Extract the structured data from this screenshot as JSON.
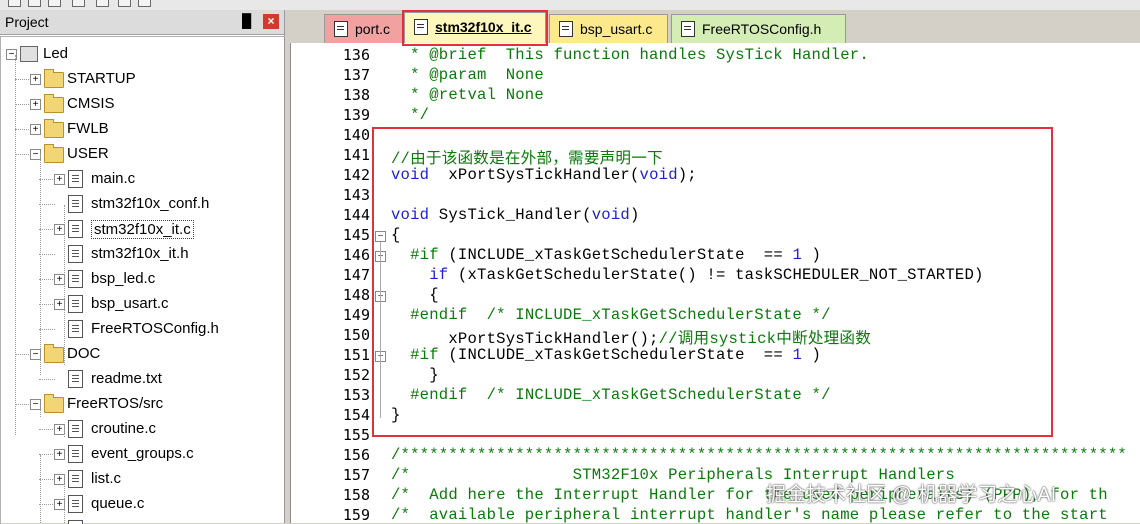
{
  "toolbar": {
    "icons": [
      "arrow-icon",
      "file-icon",
      "file-icon",
      "build-icon",
      "save-icon",
      "file-icon",
      "debug-icon"
    ]
  },
  "panel": {
    "title": "Project",
    "pin": "█",
    "close": "×"
  },
  "tree": [
    {
      "label": "Led",
      "kind": "root",
      "level": 0,
      "expander": "−"
    },
    {
      "label": "STARTUP",
      "kind": "folder",
      "level": 1,
      "expander": "+"
    },
    {
      "label": "CMSIS",
      "kind": "folder",
      "level": 1,
      "expander": "+"
    },
    {
      "label": "FWLB",
      "kind": "folder",
      "level": 1,
      "expander": "+"
    },
    {
      "label": "USER",
      "kind": "folder-open",
      "level": 1,
      "expander": "−"
    },
    {
      "label": "main.c",
      "kind": "file",
      "level": 2,
      "expander": "+"
    },
    {
      "label": "stm32f10x_conf.h",
      "kind": "file",
      "level": 2,
      "expander": ""
    },
    {
      "label": "stm32f10x_it.c",
      "kind": "file",
      "level": 2,
      "expander": "+",
      "selected": true
    },
    {
      "label": "stm32f10x_it.h",
      "kind": "file",
      "level": 2,
      "expander": ""
    },
    {
      "label": "bsp_led.c",
      "kind": "file",
      "level": 2,
      "expander": "+"
    },
    {
      "label": "bsp_usart.c",
      "kind": "file",
      "level": 2,
      "expander": "+"
    },
    {
      "label": "FreeRTOSConfig.h",
      "kind": "file",
      "level": 2,
      "expander": ""
    },
    {
      "label": "DOC",
      "kind": "folder-open",
      "level": 1,
      "expander": "−"
    },
    {
      "label": "readme.txt",
      "kind": "file",
      "level": 2,
      "expander": ""
    },
    {
      "label": "FreeRTOS/src",
      "kind": "folder-open",
      "level": 1,
      "expander": "−"
    },
    {
      "label": "croutine.c",
      "kind": "file",
      "level": 2,
      "expander": "+"
    },
    {
      "label": "event_groups.c",
      "kind": "file",
      "level": 2,
      "expander": "+"
    },
    {
      "label": "list.c",
      "kind": "file",
      "level": 2,
      "expander": "+"
    },
    {
      "label": "queue.c",
      "kind": "file",
      "level": 2,
      "expander": "+"
    },
    {
      "label": "",
      "kind": "file",
      "level": 2,
      "expander": "+"
    }
  ],
  "tabs": [
    {
      "label": "port.c",
      "bg": "#f2a1a1"
    },
    {
      "label": "stm32f10x_it.c",
      "bg": "#fdf6bd",
      "active": true
    },
    {
      "label": "bsp_usart.c",
      "bg": "#fbe98c"
    },
    {
      "label": "FreeRTOSConfig.h",
      "bg": "#d4edb5"
    }
  ],
  "editor": {
    "lines": [
      {
        "n": "136",
        "segs": [
          [
            "c-com",
            "  * @brief  This function handles SysTick Handler."
          ]
        ]
      },
      {
        "n": "137",
        "segs": [
          [
            "c-com",
            "  * @param  None"
          ]
        ]
      },
      {
        "n": "138",
        "segs": [
          [
            "c-com",
            "  * @retval None"
          ]
        ]
      },
      {
        "n": "139",
        "segs": [
          [
            "c-com",
            "  */"
          ]
        ]
      },
      {
        "n": "140",
        "segs": []
      },
      {
        "n": "141",
        "segs": [
          [
            "c-com",
            "//由于该函数是在外部，需要声明一下"
          ]
        ]
      },
      {
        "n": "142",
        "segs": [
          [
            "c-kw",
            "void"
          ],
          [
            "",
            "  xPortSysTickHandler("
          ],
          [
            "c-kw",
            "void"
          ],
          [
            "",
            ");"
          ]
        ]
      },
      {
        "n": "143",
        "segs": []
      },
      {
        "n": "144",
        "segs": [
          [
            "c-kw",
            "void"
          ],
          [
            "",
            " SysTick_Handler("
          ],
          [
            "c-kw",
            "void"
          ],
          [
            "",
            ")"
          ]
        ]
      },
      {
        "n": "145",
        "segs": [
          [
            "",
            "{"
          ]
        ]
      },
      {
        "n": "146",
        "segs": [
          [
            "c-pp",
            "  #if"
          ],
          [
            "",
            " (INCLUDE_xTaskGetSchedulerState  == "
          ],
          [
            "c-num",
            "1"
          ],
          [
            "",
            " )"
          ]
        ]
      },
      {
        "n": "147",
        "segs": [
          [
            "c-kw",
            "    if"
          ],
          [
            "",
            " (xTaskGetSchedulerState() != taskSCHEDULER_NOT_STARTED)"
          ]
        ]
      },
      {
        "n": "148",
        "segs": [
          [
            "",
            "    {"
          ]
        ]
      },
      {
        "n": "149",
        "segs": [
          [
            "c-pp",
            "  #endif"
          ],
          [
            "c-com",
            "  /* INCLUDE_xTaskGetSchedulerState */"
          ]
        ]
      },
      {
        "n": "150",
        "segs": [
          [
            "",
            "      xPortSysTickHandler();"
          ],
          [
            "c-com",
            "//调用systick中断处理函数"
          ]
        ]
      },
      {
        "n": "151",
        "segs": [
          [
            "c-pp",
            "  #if"
          ],
          [
            "",
            " (INCLUDE_xTaskGetSchedulerState  == "
          ],
          [
            "c-num",
            "1"
          ],
          [
            "",
            " )"
          ]
        ]
      },
      {
        "n": "152",
        "segs": [
          [
            "",
            "    }"
          ]
        ]
      },
      {
        "n": "153",
        "segs": [
          [
            "c-pp",
            "  #endif"
          ],
          [
            "c-com",
            "  /* INCLUDE_xTaskGetSchedulerState */"
          ]
        ]
      },
      {
        "n": "154",
        "segs": [
          [
            "",
            "}"
          ]
        ]
      },
      {
        "n": "155",
        "segs": []
      },
      {
        "n": "156",
        "segs": [
          [
            "c-com",
            "/****************************************************************************"
          ]
        ]
      },
      {
        "n": "157",
        "segs": [
          [
            "c-com",
            "/*                 STM32F10x Peripherals Interrupt Handlers"
          ]
        ]
      },
      {
        "n": "158",
        "segs": [
          [
            "c-com",
            "/*  Add here the Interrupt Handler for the used peripheral(s) (PPP), for th"
          ]
        ]
      },
      {
        "n": "159",
        "segs": [
          [
            "c-com",
            "/*  available peripheral interrupt handler's name please refer to the start"
          ]
        ]
      }
    ]
  },
  "watermark": "掘金技术社区 @ 机器学习之心AI",
  "colors": {
    "highlight": "#e0323c",
    "comment": "#0a7a0a",
    "keyword": "#1f1fd0"
  }
}
